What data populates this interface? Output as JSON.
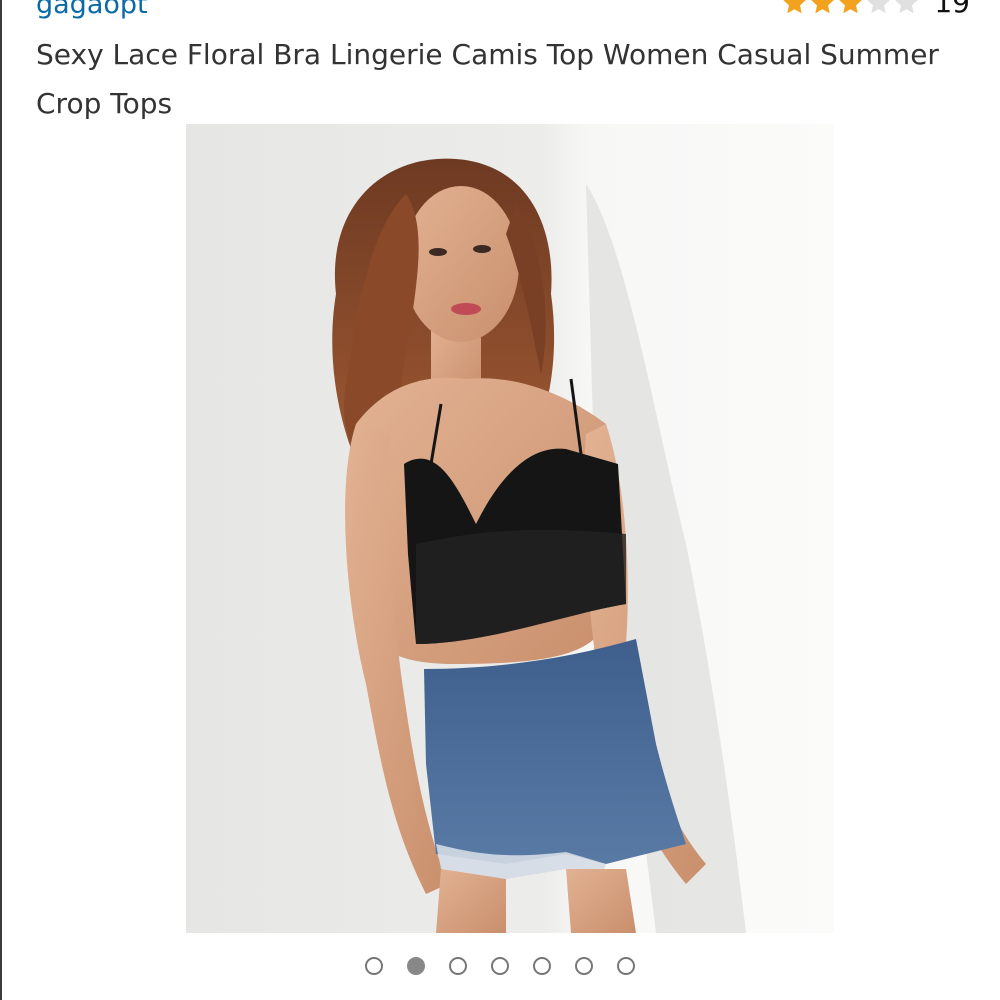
{
  "product": {
    "brand": "gagaopt",
    "title": "Sexy Lace Floral Bra Lingerie Camis Top Women Casual Summer Crop Tops",
    "rating": {
      "stars": 3,
      "max_stars": 5,
      "review_count": "19",
      "star_filled_color": "#f2a21c",
      "star_empty_color": "#e0e0e0"
    }
  },
  "image_carousel": {
    "total": 7,
    "active_index": 1
  },
  "colors": {
    "brand_link": "#0a6aa8",
    "title_text": "#333333"
  }
}
